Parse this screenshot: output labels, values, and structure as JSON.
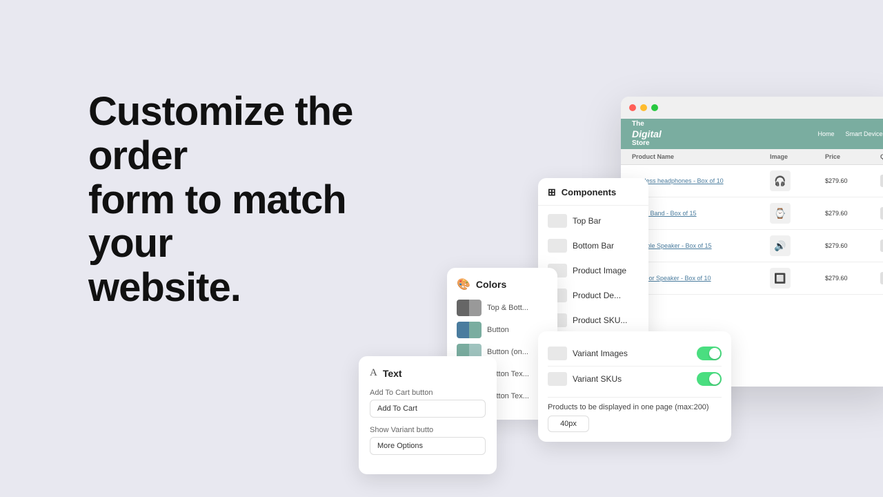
{
  "hero": {
    "heading_line1": "Customize the order",
    "heading_line2": "form to match your",
    "heading_line3": "website."
  },
  "browser": {
    "store": {
      "name_line1": "The",
      "name_digital": "Digital",
      "name_line3": "Store",
      "nav": [
        "Home",
        "Smart Devices"
      ]
    },
    "table": {
      "headers": [
        "Product Name",
        "Image",
        "Price",
        "Qua"
      ],
      "rows": [
        {
          "name": "Wireless headphones - Box of 10",
          "price": "$279.60",
          "emoji": "🎧"
        },
        {
          "name": "Smart Band - Box of 15",
          "price": "$279.60",
          "emoji": "⌚"
        },
        {
          "name": "Portable Speaker - Box of 15",
          "price": "$279.60",
          "emoji": "🔊"
        },
        {
          "name": "Outdoor Speaker - Box of 10",
          "price": "$279.60",
          "emoji": "🔲"
        }
      ]
    }
  },
  "components_panel": {
    "title": "Components",
    "items": [
      {
        "label": "Top Bar"
      },
      {
        "label": "Bottom Bar"
      },
      {
        "label": "Product Image"
      },
      {
        "label": "Product De..."
      },
      {
        "label": "Product SKU..."
      }
    ]
  },
  "colors_panel": {
    "title": "Colors",
    "items": [
      {
        "label": "Top & Bott...",
        "color1": "#666",
        "color2": "#999"
      },
      {
        "label": "Button",
        "color1": "#4a7c9e",
        "color2": "#7aada0"
      },
      {
        "label": "Button (on...",
        "color1": "#7aada0",
        "color2": "#a0c4bf"
      },
      {
        "label": "Button Tex...",
        "color1": "#eee",
        "color2": "#ddd"
      },
      {
        "label": "Button Tex...",
        "color1": "#ccc",
        "color2": "#bbb"
      }
    ]
  },
  "text_panel": {
    "title": "Text",
    "fields": [
      {
        "label": "Add To Cart button",
        "value": "Add To Cart"
      },
      {
        "label": "Show Variant butto",
        "value": "More Options"
      }
    ]
  },
  "settings_panel": {
    "rows": [
      {
        "label": "Variant Images",
        "enabled": true
      },
      {
        "label": "Variant SKUs",
        "enabled": true
      }
    ],
    "bottom": {
      "label": "Products to be displayed in one page (max:200)",
      "value": "40px"
    }
  }
}
